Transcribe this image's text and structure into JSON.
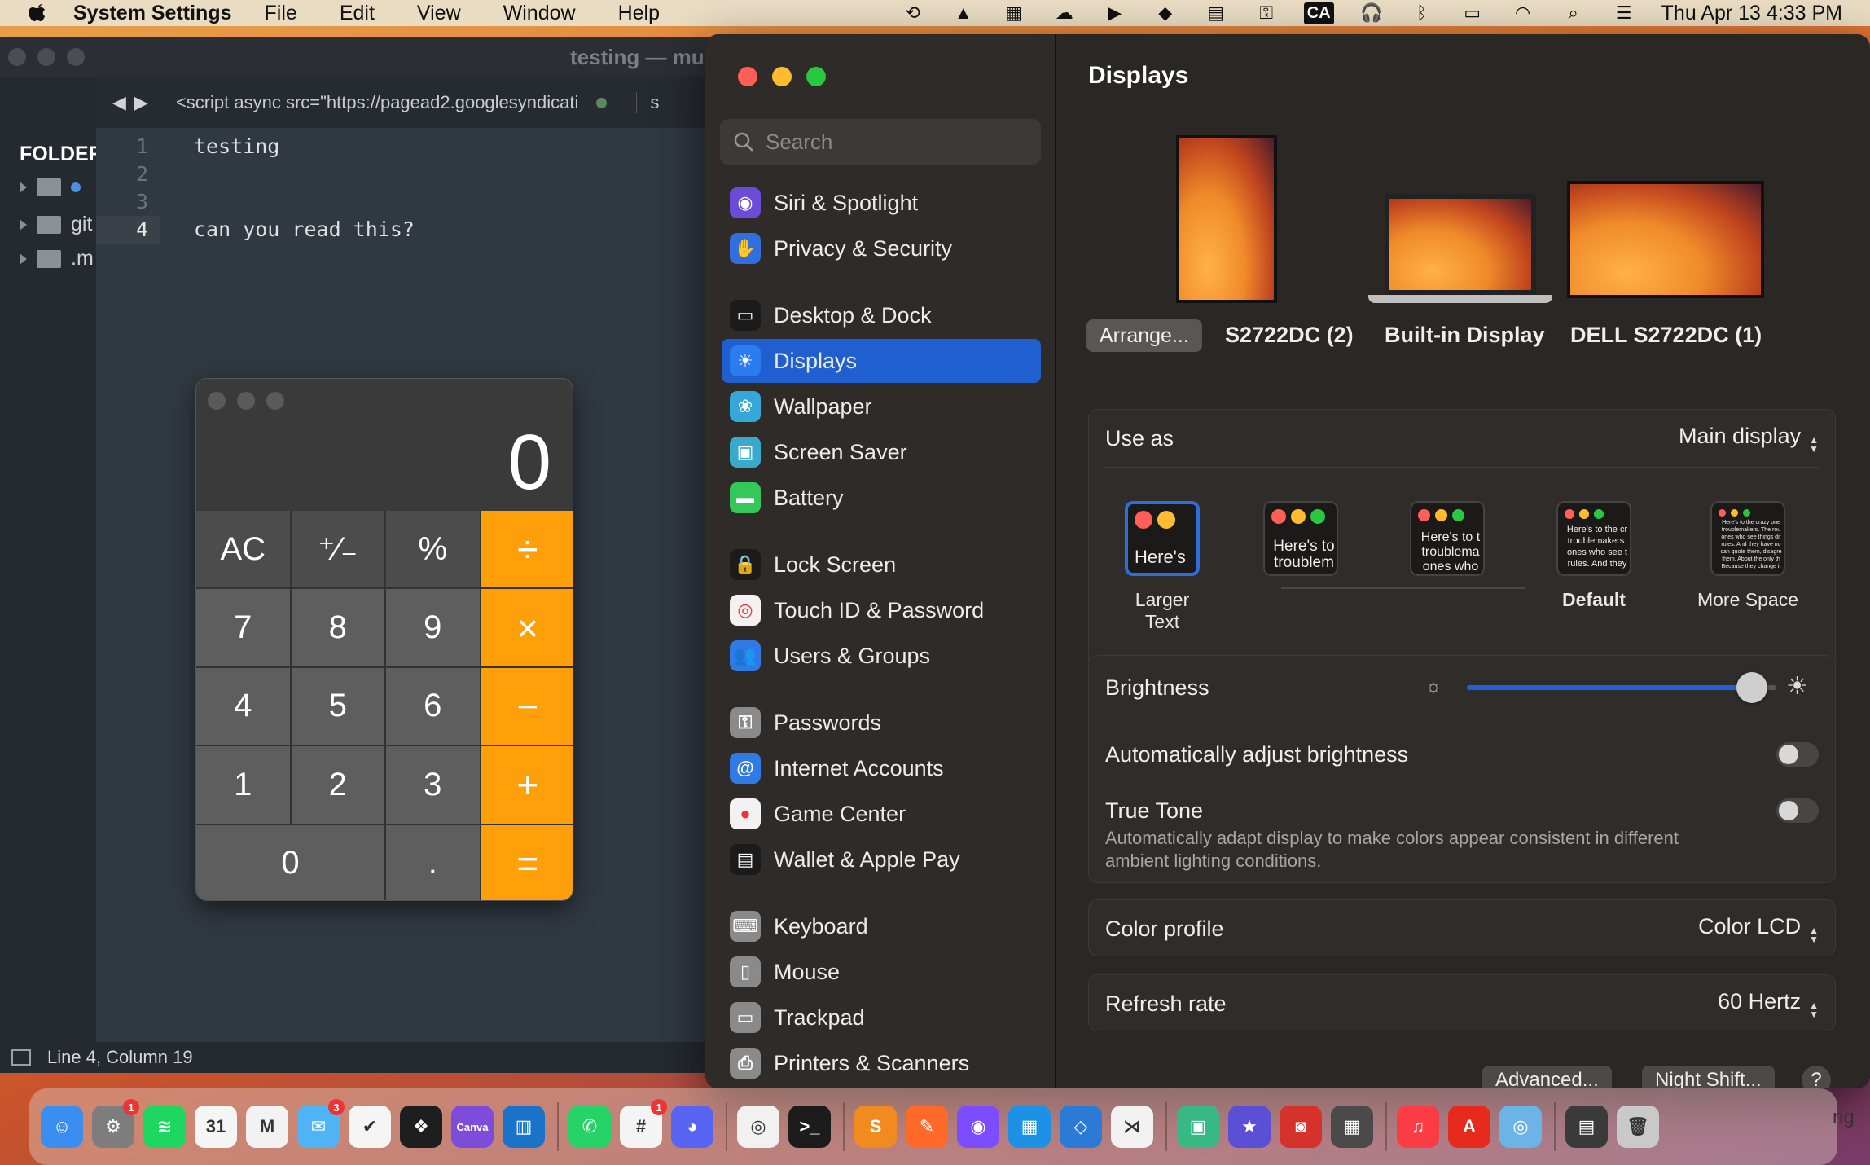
{
  "menubar": {
    "app_name": "System Settings",
    "menus": [
      "File",
      "Edit",
      "View",
      "Window",
      "Help"
    ],
    "ca_label": "CA",
    "datetime": "Thu Apr 13  4:33 PM"
  },
  "editor": {
    "title": "testing — mu",
    "sidebar_header": "FOLDER",
    "folders": [
      "",
      "git",
      ".m"
    ],
    "tab_label": "<script async src=\"https://pagead2.googlesyndicati",
    "tab2_label": "s",
    "lines": [
      {
        "num": "1",
        "text": "testing"
      },
      {
        "num": "2",
        "text": ""
      },
      {
        "num": "3",
        "text": ""
      },
      {
        "num": "4",
        "text": "can you read this?"
      }
    ],
    "status": "Line 4, Column 19"
  },
  "calculator": {
    "display": "0",
    "keys": [
      "AC",
      "⁺∕₋",
      "%",
      "÷",
      "7",
      "8",
      "9",
      "×",
      "4",
      "5",
      "6",
      "−",
      "1",
      "2",
      "3",
      "+",
      "0",
      ".",
      "="
    ]
  },
  "settings": {
    "search_placeholder": "Search",
    "sidebar": [
      {
        "label": "Siri & Spotlight",
        "color": "#6b4bd8",
        "glyph": "◉"
      },
      {
        "label": "Privacy & Security",
        "color": "#2f6fdf",
        "glyph": "✋"
      },
      {
        "label": "Desktop & Dock",
        "color": "#1b1b1b",
        "glyph": "▭"
      },
      {
        "label": "Displays",
        "color": "#2a7cf0",
        "glyph": "☀"
      },
      {
        "label": "Wallpaper",
        "color": "#35a7d8",
        "glyph": "❀"
      },
      {
        "label": "Screen Saver",
        "color": "#39a9cc",
        "glyph": "▣"
      },
      {
        "label": "Battery",
        "color": "#34c759",
        "glyph": "▬"
      },
      {
        "label": "Lock Screen",
        "color": "#1b1b1b",
        "glyph": "🔒"
      },
      {
        "label": "Touch ID & Password",
        "color": "#f4f1f0",
        "glyph": "◎"
      },
      {
        "label": "Users & Groups",
        "color": "#2f7ae5",
        "glyph": "👥"
      },
      {
        "label": "Passwords",
        "color": "#8a8a8a",
        "glyph": "⚿"
      },
      {
        "label": "Internet Accounts",
        "color": "#2f7ae5",
        "glyph": "@"
      },
      {
        "label": "Game Center",
        "color": "#f2f2f2",
        "glyph": "●"
      },
      {
        "label": "Wallet & Apple Pay",
        "color": "#1b1b1b",
        "glyph": "▤"
      },
      {
        "label": "Keyboard",
        "color": "#8a8a8a",
        "glyph": "⌨"
      },
      {
        "label": "Mouse",
        "color": "#8a8a8a",
        "glyph": "▯"
      },
      {
        "label": "Trackpad",
        "color": "#8a8a8a",
        "glyph": "▭"
      },
      {
        "label": "Printers & Scanners",
        "color": "#8a8a8a",
        "glyph": "⎙"
      }
    ],
    "selected": "Displays",
    "page_title": "Displays",
    "arrange_label": "Arrange...",
    "monitors": [
      "S2722DC (2)",
      "Built-in Display",
      "DELL S2722DC (1)"
    ],
    "use_as_label": "Use as",
    "use_as_value": "Main display",
    "resolutions": [
      {
        "label": "Larger Text",
        "sample": "Here's"
      },
      {
        "label": "",
        "sample": "Here's to troublem"
      },
      {
        "label": "",
        "sample": "Here's to t troublema ones who"
      },
      {
        "label": "Default",
        "sample": "Here's to the cr troublemakers. ones who see t rules. And they"
      },
      {
        "label": "More Space",
        "sample": "Here's to the crazy one troublemakers. The rou ones who see things dif rules. And they have no can quote them, disagre them. About the only th Because they change it"
      }
    ],
    "brightness_label": "Brightness",
    "brightness_level": 0.92,
    "auto_brightness_label": "Automatically adjust brightness",
    "true_tone_label": "True Tone",
    "true_tone_desc": "Automatically adapt display to make colors appear consistent in different ambient lighting conditions.",
    "color_profile_label": "Color profile",
    "color_profile_value": "Color LCD",
    "refresh_label": "Refresh rate",
    "refresh_value": "60 Hertz",
    "advanced_label": "Advanced...",
    "night_shift_label": "Night Shift...",
    "help_label": "?"
  },
  "dock": {
    "apps": [
      {
        "name": "finder-icon",
        "color": "#3a8ef0",
        "glyph": "☺"
      },
      {
        "name": "system-settings-icon",
        "color": "#7d7d7d",
        "glyph": "⚙",
        "badge": "1"
      },
      {
        "name": "spotify-icon",
        "color": "#1ed760",
        "glyph": "≋"
      },
      {
        "name": "calendar-icon",
        "color": "#f5f5f5",
        "glyph": "31"
      },
      {
        "name": "gmail-icon",
        "color": "#f2f2f2",
        "glyph": "M"
      },
      {
        "name": "mail-icon",
        "color": "#4fb4f5",
        "glyph": "✉",
        "badge": "3"
      },
      {
        "name": "tasks-icon",
        "color": "#f5f5f5",
        "glyph": "✔"
      },
      {
        "name": "figma-icon",
        "color": "#1e1e1e",
        "glyph": "❖"
      },
      {
        "name": "canva-icon",
        "color": "#7d4cdb",
        "glyph": "Canva"
      },
      {
        "name": "trello-icon",
        "color": "#1a73c8",
        "glyph": "▥"
      },
      {
        "sep": true
      },
      {
        "name": "whatsapp-icon",
        "color": "#25d366",
        "glyph": "✆"
      },
      {
        "name": "slack-icon",
        "color": "#f4f4f4",
        "glyph": "#",
        "badge": "1"
      },
      {
        "name": "discord-icon",
        "color": "#5865f2",
        "glyph": "◕"
      },
      {
        "sep": true
      },
      {
        "name": "chrome-icon",
        "color": "#f1f1f1",
        "glyph": "◎"
      },
      {
        "name": "terminal-icon",
        "color": "#1c1c1c",
        "glyph": ">_"
      },
      {
        "sep": true
      },
      {
        "name": "sublime-icon",
        "color": "#f28b1f",
        "glyph": "S"
      },
      {
        "name": "pencil-icon",
        "color": "#ff6a2b",
        "glyph": "✎"
      },
      {
        "name": "github-icon",
        "color": "#7c4dff",
        "glyph": "◉"
      },
      {
        "name": "docker-icon",
        "color": "#1d91e6",
        "glyph": "▦"
      },
      {
        "name": "sourcetree-icon",
        "color": "#2b7bd6",
        "glyph": "◇"
      },
      {
        "name": "vscode-icon",
        "color": "#f1f1f1",
        "glyph": "⋊"
      },
      {
        "sep": true
      },
      {
        "name": "screen-capture-icon",
        "color": "#37b884",
        "glyph": "▣"
      },
      {
        "name": "imovie-icon",
        "color": "#5b4fd6",
        "glyph": "★"
      },
      {
        "name": "photo-booth-icon",
        "color": "#d5322b",
        "glyph": "◙"
      },
      {
        "name": "calculator-icon",
        "color": "#4a4a4a",
        "glyph": "▦"
      },
      {
        "sep": true
      },
      {
        "name": "music-icon",
        "color": "#fc3c44",
        "glyph": "♫"
      },
      {
        "name": "acrobat-icon",
        "color": "#e62b1e",
        "glyph": "A"
      },
      {
        "name": "preview-icon",
        "color": "#6db4e6",
        "glyph": "◎"
      },
      {
        "sep": true
      },
      {
        "name": "desktop-stack-icon",
        "color": "#3a3a3a",
        "glyph": "▤"
      },
      {
        "name": "trash-icon",
        "color": "#c9c9c9",
        "glyph": "🗑"
      }
    ],
    "partial_label": "ng"
  }
}
